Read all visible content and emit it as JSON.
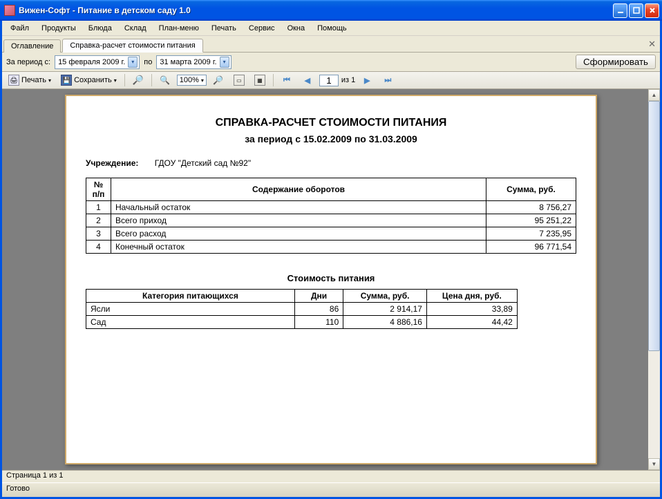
{
  "window": {
    "title": "Вижен-Софт - Питание в детском саду 1.0"
  },
  "menubar": [
    "Файл",
    "Продукты",
    "Блюда",
    "Склад",
    "План-меню",
    "Печать",
    "Сервис",
    "Окна",
    "Помощь"
  ],
  "tabs": {
    "tab0": "Оглавление",
    "tab1": "Справка-расчет стоимости питания"
  },
  "filter": {
    "period_lbl": "За период с:",
    "date_from": "15 февраля 2009 г.",
    "to_lbl": "по",
    "date_to": "31   марта    2009 г.",
    "form_btn": "Сформировать"
  },
  "toolbar": {
    "print": "Печать",
    "save": "Сохранить",
    "zoom": "100%",
    "page": "1",
    "page_of": "из 1"
  },
  "report": {
    "title": "СПРАВКА-РАСЧЕТ СТОИМОСТИ ПИТАНИЯ",
    "subtitle": "за период с 15.02.2009 по 31.03.2009",
    "inst_lbl": "Учреждение:",
    "inst_val": "ГДОУ \"Детский сад №92\"",
    "t1": {
      "h_num": "№ п/п",
      "h_desc": "Содержание оборотов",
      "h_sum": "Сумма, руб.",
      "rows": [
        {
          "n": "1",
          "d": "Начальный остаток",
          "s": "8 756,27"
        },
        {
          "n": "2",
          "d": "Всего приход",
          "s": "95 251,22"
        },
        {
          "n": "3",
          "d": "Всего расход",
          "s": "7 235,95"
        },
        {
          "n": "4",
          "d": "Конечный остаток",
          "s": "96 771,54"
        }
      ]
    },
    "sub2": "Стоимость питания",
    "t2": {
      "h_cat": "Категория питающихся",
      "h_days": "Дни",
      "h_sum": "Сумма, руб.",
      "h_price": "Цена дня, руб.",
      "rows": [
        {
          "c": "Ясли",
          "d": "86",
          "s": "2 914,17",
          "p": "33,89"
        },
        {
          "c": "Сад",
          "d": "110",
          "s": "4 886,16",
          "p": "44,42"
        }
      ]
    }
  },
  "status": {
    "page": "Страница 1 из 1",
    "ready": "Готово"
  }
}
